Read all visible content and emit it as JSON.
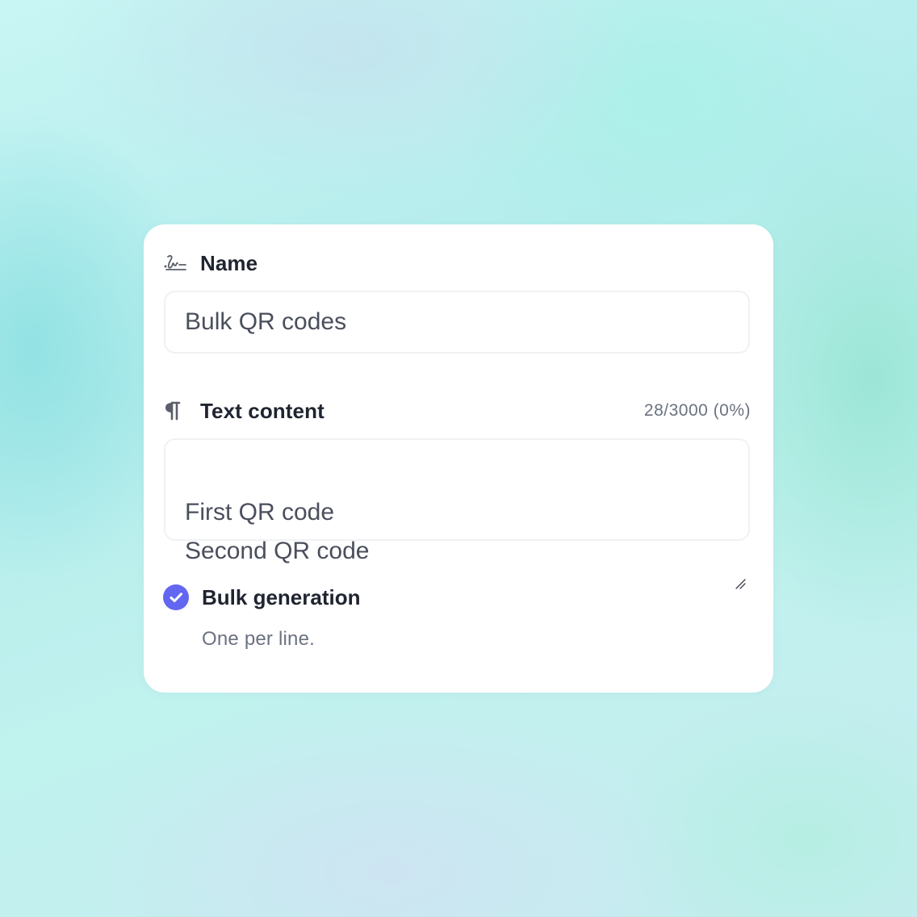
{
  "name_field": {
    "label": "Name",
    "value": "Bulk QR codes",
    "icon": "signature-icon"
  },
  "text_content_field": {
    "label": "Text content",
    "counter": "28/3000 (0%)",
    "value": "First QR code\nSecond QR code",
    "icon": "pilcrow-icon"
  },
  "bulk_generation": {
    "label": "Bulk generation",
    "help": "One per line.",
    "checked": true,
    "icon": "check-circle-icon"
  },
  "colors": {
    "accent": "#6366f1",
    "label_text": "#1f2430",
    "muted_text": "#6b7280",
    "input_text": "#4a4f5c",
    "input_border": "#f0f1f4",
    "card_bg": "#ffffff"
  }
}
